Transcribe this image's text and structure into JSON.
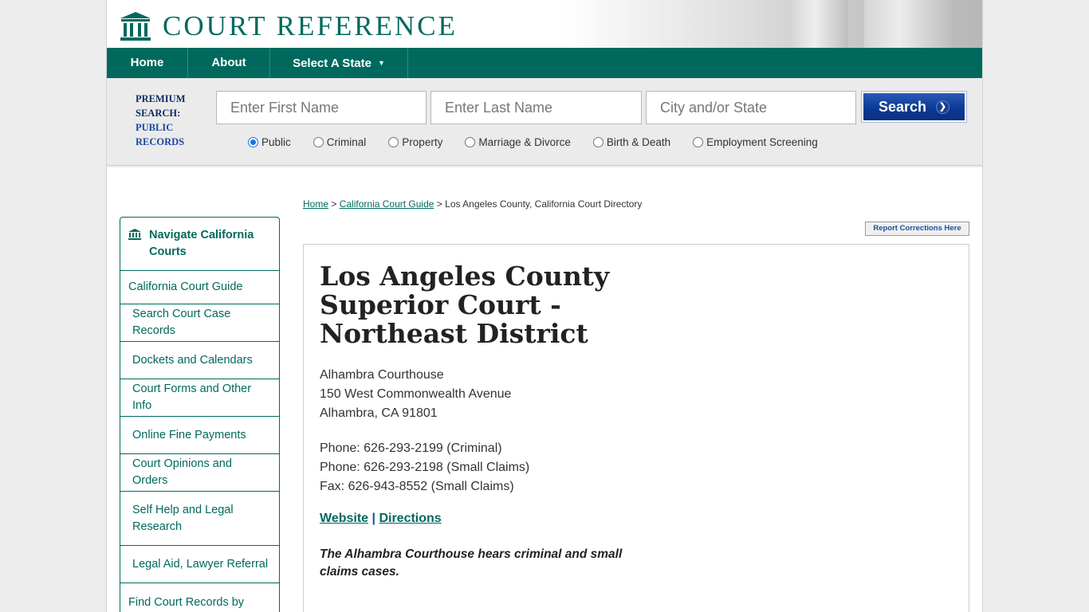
{
  "header": {
    "logo_text": "COURT REFERENCE",
    "logo_icon": "courthouse-icon"
  },
  "nav": {
    "items": [
      {
        "label": "Home"
      },
      {
        "label": "About"
      },
      {
        "label": "Select A State",
        "caret": "▼"
      }
    ]
  },
  "search": {
    "premium_line1": "PREMIUM",
    "premium_line2": "SEARCH:",
    "premium_line3": "PUBLIC",
    "premium_line4": "RECORDS",
    "first_name_placeholder": "Enter First Name",
    "last_name_placeholder": "Enter Last Name",
    "city_state_placeholder": "City and/or State",
    "button_label": "Search",
    "button_icon": "chevron-right-icon",
    "record_types": [
      {
        "label": "Public",
        "selected": true
      },
      {
        "label": "Criminal",
        "selected": false
      },
      {
        "label": "Property",
        "selected": false
      },
      {
        "label": "Marriage & Divorce",
        "selected": false
      },
      {
        "label": "Birth & Death",
        "selected": false
      },
      {
        "label": "Employment Screening",
        "selected": false
      }
    ]
  },
  "breadcrumb": {
    "home": "Home",
    "sep": ">",
    "guide": "California Court Guide",
    "current": "Los Angeles County, California Court Directory"
  },
  "report_corrections": "Report Corrections Here",
  "sidebar": {
    "title": "Navigate California Courts",
    "title_icon": "courthouse-icon",
    "items": [
      {
        "label": "California Court Guide"
      },
      {
        "label": "Search Court Case Records"
      },
      {
        "label": "Dockets and Calendars"
      },
      {
        "label": "Court Forms and Other Info"
      },
      {
        "label": "Online Fine Payments"
      },
      {
        "label": "Court Opinions and Orders"
      },
      {
        "label": "Self Help and Legal Research"
      },
      {
        "label": "Legal Aid, Lawyer Referral"
      },
      {
        "label": "Find Court Records by California County"
      }
    ]
  },
  "court": {
    "name": "Los Angeles County Superior Court - Northeast District",
    "address_line1": "Alhambra Courthouse",
    "address_line2": "150 West Commonwealth Avenue",
    "address_line3": "Alhambra, CA 91801",
    "phone1": "Phone: 626-293-2199 (Criminal)",
    "phone2": "Phone: 626-293-2198 (Small Claims)",
    "fax": "Fax: 626-943-8552 (Small Claims)",
    "website_label": "Website",
    "link_sep": "|",
    "directions_label": "Directions",
    "description": "The Alhambra Courthouse hears criminal and small claims cases."
  },
  "colors": {
    "brand": "#00695e",
    "search_button": "#0b3a94",
    "premium_text": "#0a2d5e"
  }
}
